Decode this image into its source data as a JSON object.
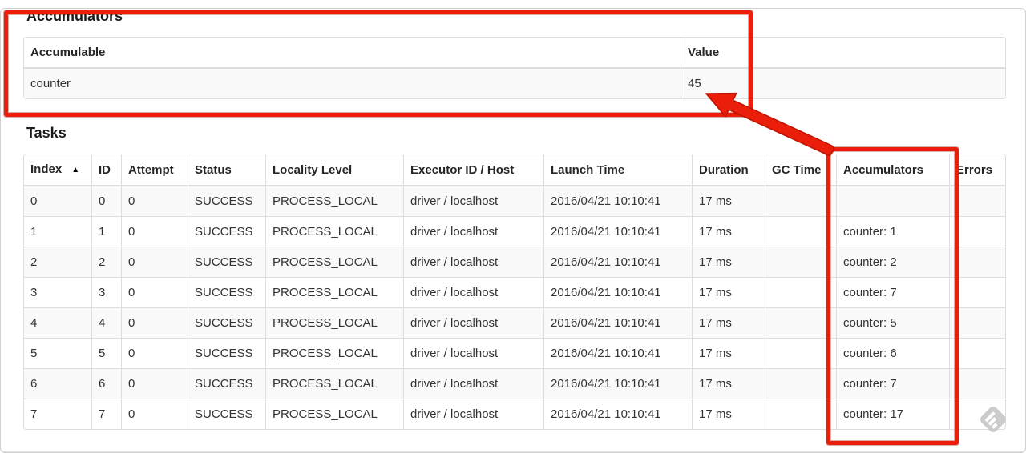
{
  "annotations": {
    "color": "#ea1e0b",
    "outline_color": "#bf1504"
  },
  "accumulators_section": {
    "title": "Accumulators",
    "table": {
      "headers": [
        "Accumulable",
        "Value"
      ],
      "rows": [
        {
          "accumulable": "counter",
          "value": "45"
        }
      ]
    }
  },
  "tasks_section": {
    "title": "Tasks",
    "table": {
      "headers": [
        "Index",
        "ID",
        "Attempt",
        "Status",
        "Locality Level",
        "Executor ID / Host",
        "Launch Time",
        "Duration",
        "GC Time",
        "Accumulators",
        "Errors"
      ],
      "sort_indicator": "▲",
      "rows": [
        [
          "0",
          "0",
          "0",
          "SUCCESS",
          "PROCESS_LOCAL",
          "driver / localhost",
          "2016/04/21 10:10:41",
          "17 ms",
          "",
          "",
          ""
        ],
        [
          "1",
          "1",
          "0",
          "SUCCESS",
          "PROCESS_LOCAL",
          "driver / localhost",
          "2016/04/21 10:10:41",
          "17 ms",
          "",
          "counter: 1",
          ""
        ],
        [
          "2",
          "2",
          "0",
          "SUCCESS",
          "PROCESS_LOCAL",
          "driver / localhost",
          "2016/04/21 10:10:41",
          "17 ms",
          "",
          "counter: 2",
          ""
        ],
        [
          "3",
          "3",
          "0",
          "SUCCESS",
          "PROCESS_LOCAL",
          "driver / localhost",
          "2016/04/21 10:10:41",
          "17 ms",
          "",
          "counter: 7",
          ""
        ],
        [
          "4",
          "4",
          "0",
          "SUCCESS",
          "PROCESS_LOCAL",
          "driver / localhost",
          "2016/04/21 10:10:41",
          "17 ms",
          "",
          "counter: 5",
          ""
        ],
        [
          "5",
          "5",
          "0",
          "SUCCESS",
          "PROCESS_LOCAL",
          "driver / localhost",
          "2016/04/21 10:10:41",
          "17 ms",
          "",
          "counter: 6",
          ""
        ],
        [
          "6",
          "6",
          "0",
          "SUCCESS",
          "PROCESS_LOCAL",
          "driver / localhost",
          "2016/04/21 10:10:41",
          "17 ms",
          "",
          "counter: 7",
          ""
        ],
        [
          "7",
          "7",
          "0",
          "SUCCESS",
          "PROCESS_LOCAL",
          "driver / localhost",
          "2016/04/21 10:10:41",
          "17 ms",
          "",
          "counter: 17",
          ""
        ]
      ]
    }
  }
}
